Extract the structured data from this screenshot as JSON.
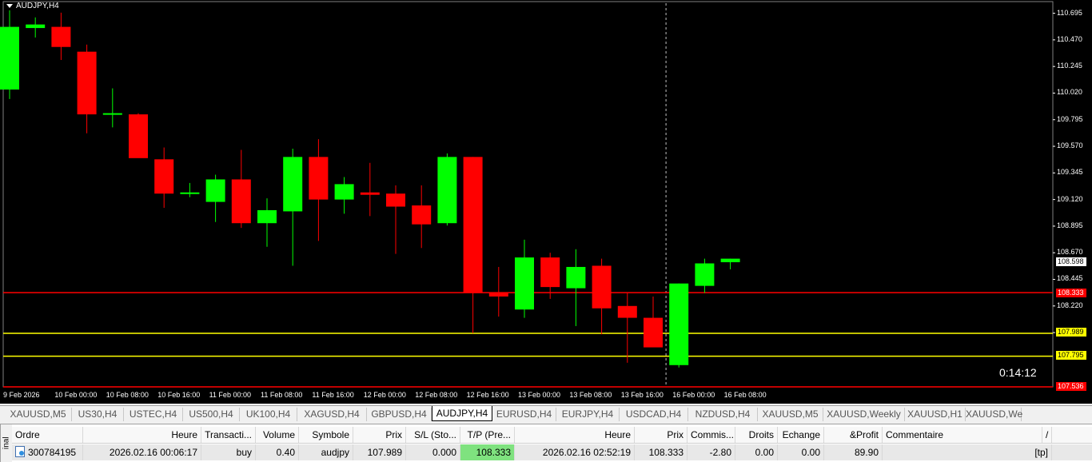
{
  "chart": {
    "symbol_title": "AUDJPY,H4",
    "timer": "0:14:12",
    "colors": {
      "bull": "#00ff00",
      "bear": "#ff0000",
      "background": "#000000",
      "line_red": "#ff0000",
      "line_yellow": "#ffff00"
    },
    "price_axis": [
      "110.695",
      "110.470",
      "110.245",
      "110.020",
      "109.795",
      "109.570",
      "109.345",
      "109.120",
      "108.895",
      "108.670",
      "108.445",
      "108.220",
      "107.995"
    ],
    "time_axis": [
      "9 Feb 2026",
      "10 Feb 00:00",
      "10 Feb 08:00",
      "10 Feb 16:00",
      "11 Feb 00:00",
      "11 Feb 08:00",
      "11 Feb 16:00",
      "12 Feb 00:00",
      "12 Feb 08:00",
      "12 Feb 16:00",
      "13 Feb 00:00",
      "13 Feb 08:00",
      "13 Feb 16:00",
      "16 Feb 00:00",
      "16 Feb 08:00"
    ],
    "price_labels": {
      "bid": "108.598",
      "tp": "108.333",
      "open": "107.989",
      "level2": "107.795",
      "bottom": "107.536"
    }
  },
  "chart_data": {
    "type": "candlestick",
    "symbol": "AUDJPY",
    "timeframe": "H4",
    "ylim": [
      107.536,
      110.78
    ],
    "hlines": [
      {
        "price": 108.333,
        "color": "#ff0000"
      },
      {
        "price": 107.989,
        "color": "#ffff00"
      },
      {
        "price": 107.795,
        "color": "#ffff00"
      },
      {
        "price": 107.536,
        "color": "#ff0000"
      }
    ],
    "crosshair_index": 25.5,
    "candles": [
      {
        "o": 110.05,
        "h": 110.72,
        "l": 109.97,
        "c": 110.58
      },
      {
        "o": 110.57,
        "h": 110.66,
        "l": 110.49,
        "c": 110.6
      },
      {
        "o": 110.58,
        "h": 110.7,
        "l": 110.3,
        "c": 110.41
      },
      {
        "o": 110.37,
        "h": 110.43,
        "l": 109.68,
        "c": 109.84
      },
      {
        "o": 109.84,
        "h": 110.06,
        "l": 109.73,
        "c": 109.85
      },
      {
        "o": 109.84,
        "h": 109.85,
        "l": 109.48,
        "c": 109.47
      },
      {
        "o": 109.46,
        "h": 109.56,
        "l": 109.05,
        "c": 109.17
      },
      {
        "o": 109.17,
        "h": 109.26,
        "l": 109.14,
        "c": 109.18
      },
      {
        "o": 109.1,
        "h": 109.33,
        "l": 108.93,
        "c": 109.29
      },
      {
        "o": 109.29,
        "h": 109.54,
        "l": 108.88,
        "c": 108.92
      },
      {
        "o": 108.92,
        "h": 109.13,
        "l": 108.72,
        "c": 109.03
      },
      {
        "o": 109.02,
        "h": 109.55,
        "l": 108.56,
        "c": 109.48
      },
      {
        "o": 109.48,
        "h": 109.63,
        "l": 108.77,
        "c": 109.12
      },
      {
        "o": 109.12,
        "h": 109.31,
        "l": 109.0,
        "c": 109.25
      },
      {
        "o": 109.18,
        "h": 109.43,
        "l": 108.98,
        "c": 109.16
      },
      {
        "o": 109.17,
        "h": 109.24,
        "l": 108.66,
        "c": 109.06
      },
      {
        "o": 109.07,
        "h": 109.24,
        "l": 108.71,
        "c": 108.91
      },
      {
        "o": 108.92,
        "h": 109.51,
        "l": 108.9,
        "c": 109.48
      },
      {
        "o": 109.48,
        "h": 109.48,
        "l": 107.99,
        "c": 108.33
      },
      {
        "o": 108.33,
        "h": 108.55,
        "l": 108.13,
        "c": 108.3
      },
      {
        "o": 108.19,
        "h": 108.78,
        "l": 108.12,
        "c": 108.63
      },
      {
        "o": 108.63,
        "h": 108.67,
        "l": 108.28,
        "c": 108.38
      },
      {
        "o": 108.37,
        "h": 108.7,
        "l": 108.05,
        "c": 108.55
      },
      {
        "o": 108.56,
        "h": 108.62,
        "l": 107.98,
        "c": 108.2
      },
      {
        "o": 108.22,
        "h": 108.33,
        "l": 107.74,
        "c": 108.12
      },
      {
        "o": 108.12,
        "h": 108.3,
        "l": 108.0,
        "c": 107.87
      },
      {
        "o": 107.72,
        "h": 108.41,
        "l": 107.7,
        "c": 108.41
      },
      {
        "o": 108.39,
        "h": 108.62,
        "l": 108.33,
        "c": 108.58
      },
      {
        "o": 108.59,
        "h": 108.62,
        "l": 108.53,
        "c": 108.62
      }
    ]
  },
  "tabs": [
    "XAUUSD,M5",
    "US30,H4",
    "USTEC,H4",
    "US500,H4",
    "UK100,H4",
    "XAGUSD,H4",
    "GBPUSD,H4",
    "AUDJPY,H4",
    "EURUSD,H4",
    "EURJPY,H4",
    "USDCAD,H4",
    "NZDUSD,H4",
    "XAUUSD,M5",
    "XAUUSD,Weekly",
    "XAUUSD,H1",
    "XAUUSD,We"
  ],
  "active_tab": "AUDJPY,H4",
  "terminal": {
    "side_label": "inal",
    "headers": [
      "Ordre",
      "Heure",
      "Transacti...",
      "Volume",
      "Symbole",
      "Prix",
      "S/L (Sto...",
      "T/P (Pre...",
      "Heure",
      "Prix",
      "Commis...",
      "Droits",
      "Echange",
      "&Profit",
      "Commentaire",
      "/"
    ],
    "row": [
      "300784195",
      "2026.02.16 00:06:17",
      "buy",
      "0.40",
      "audjpy",
      "107.989",
      "0.000",
      "108.333",
      "2026.02.16 02:52:19",
      "108.333",
      "-2.80",
      "0.00",
      "0.00",
      "89.90",
      "[tp]"
    ]
  }
}
